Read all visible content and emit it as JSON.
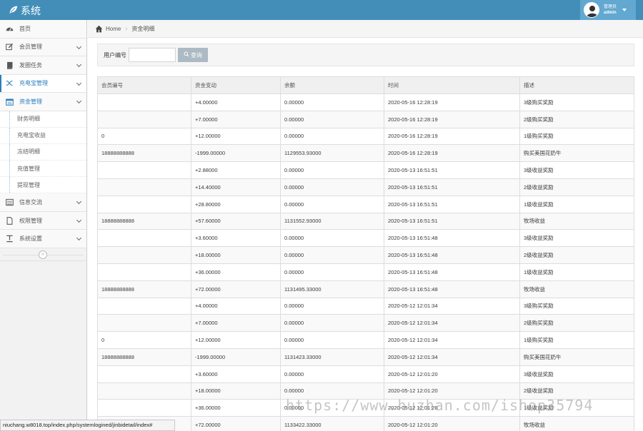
{
  "app": {
    "title": "系统"
  },
  "user": {
    "role": "管理员",
    "name": "admin"
  },
  "sidebar": {
    "items": [
      {
        "label": "首页",
        "icon": "dashboard-icon",
        "expandable": false
      },
      {
        "label": "会员管理",
        "icon": "edit-icon",
        "expandable": true
      },
      {
        "label": "发圈任务",
        "icon": "book-icon",
        "expandable": true
      },
      {
        "label": "充电宝管理",
        "icon": "random-icon",
        "expandable": true
      },
      {
        "label": "资金管理",
        "icon": "calendar-icon",
        "expandable": true
      }
    ],
    "fund_submenu": [
      "财务明细",
      "充电宝收益",
      "冻结明细",
      "充值管理",
      "提现管理"
    ],
    "items_after": [
      {
        "label": "信息交流",
        "icon": "list-icon"
      },
      {
        "label": "权限管理",
        "icon": "file-icon"
      },
      {
        "label": "系统设置",
        "icon": "text-width-icon"
      }
    ],
    "collapse_glyph": "«"
  },
  "breadcrumb": {
    "home": "Home",
    "separator": "›",
    "current": "资金明细"
  },
  "search": {
    "label": "用户编号",
    "value": "",
    "button": "查询"
  },
  "table": {
    "headers": [
      "会员编号",
      "资金变动",
      "余额",
      "时间",
      "描述"
    ],
    "rows": [
      [
        "",
        "+4.00000",
        "0.00000",
        "2020-05-16 12:28:19",
        "3级购买奖励"
      ],
      [
        "",
        "+7.00000",
        "0.00000",
        "2020-05-16 12:28:19",
        "2级购买奖励"
      ],
      [
        "0",
        "+12.00000",
        "0.00000",
        "2020-05-16 12:28:19",
        "1级购买奖励"
      ],
      [
        "18888888888",
        "-1999.00000",
        "1129553.93000",
        "2020-05-16 12:28:19",
        "购买美国花奶牛"
      ],
      [
        "",
        "+2.88000",
        "0.00000",
        "2020-05-13 16:51:51",
        "3级收益奖励"
      ],
      [
        "",
        "+14.40000",
        "0.00000",
        "2020-05-13 16:51:51",
        "2级收益奖励"
      ],
      [
        "",
        "+28.80000",
        "0.00000",
        "2020-05-13 16:51:51",
        "1级收益奖励"
      ],
      [
        "18888888888",
        "+57.60000",
        "1131552.93000",
        "2020-05-13 16:51:51",
        "牧场收益"
      ],
      [
        "",
        "+3.60000",
        "0.00000",
        "2020-05-13 16:51:48",
        "3级收益奖励"
      ],
      [
        "",
        "+18.00000",
        "0.00000",
        "2020-05-13 16:51:48",
        "2级收益奖励"
      ],
      [
        "",
        "+36.00000",
        "0.00000",
        "2020-05-13 16:51:48",
        "1级收益奖励"
      ],
      [
        "18888888888",
        "+72.00000",
        "1131495.33000",
        "2020-05-13 16:51:48",
        "牧场收益"
      ],
      [
        "",
        "+4.00000",
        "0.00000",
        "2020-05-12 12:01:34",
        "3级购买奖励"
      ],
      [
        "",
        "+7.00000",
        "0.00000",
        "2020-05-12 12:01:34",
        "2级购买奖励"
      ],
      [
        "0",
        "+12.00000",
        "0.00000",
        "2020-05-12 12:01:34",
        "1级购买奖励"
      ],
      [
        "18888888888",
        "-1999.00000",
        "1131423.33000",
        "2020-05-12 12:01:34",
        "购买美国花奶牛"
      ],
      [
        "",
        "+3.60000",
        "0.00000",
        "2020-05-12 12:01:20",
        "3级收益奖励"
      ],
      [
        "",
        "+18.00000",
        "0.00000",
        "2020-05-12 12:01:20",
        "2级收益奖励"
      ],
      [
        "",
        "+36.00000",
        "0.00000",
        "2020-05-12 12:01:20",
        "1级收益奖励"
      ],
      [
        "",
        "+72.00000",
        "1133422.33000",
        "2020-05-12 12:01:20",
        "牧场收益"
      ]
    ]
  },
  "statusbar": {
    "url": "niuchang.w8018.top/index.php/systemlogined/jinbidetail/index#"
  },
  "watermark": {
    "text": "https://www.huzhan.com/ishop35794"
  },
  "colors": {
    "header": "#438eb9",
    "user_box": "#62a8d1",
    "active": "#2b7dbc",
    "search_button": "#abbac3"
  }
}
